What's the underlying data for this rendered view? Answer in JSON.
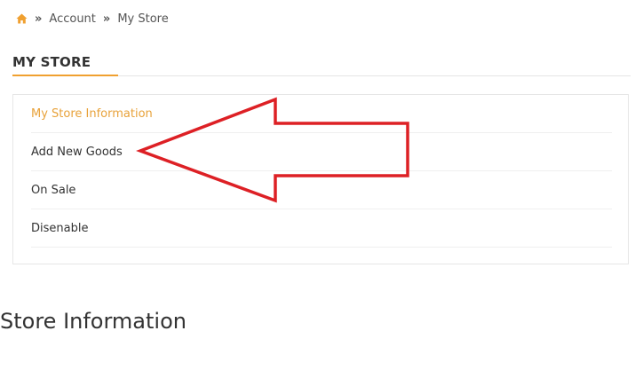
{
  "breadcrumb": {
    "items": [
      {
        "icon": "home-icon"
      },
      {
        "label": "Account"
      },
      {
        "label": "My Store"
      }
    ],
    "separator": "»"
  },
  "section": {
    "title": "MY STORE",
    "accent_color": "#f0a030"
  },
  "menu": {
    "items": [
      {
        "label": "My Store Information",
        "active": true
      },
      {
        "label": "Add New Goods",
        "active": false
      },
      {
        "label": "On Sale",
        "active": false
      },
      {
        "label": "Disenable",
        "active": false
      }
    ],
    "active_color": "#e8a23a"
  },
  "annotation": {
    "icon": "red-arrow-annotation",
    "color": "#dd2025",
    "points_to": "Add New Goods"
  },
  "content": {
    "heading": "Store Information"
  }
}
